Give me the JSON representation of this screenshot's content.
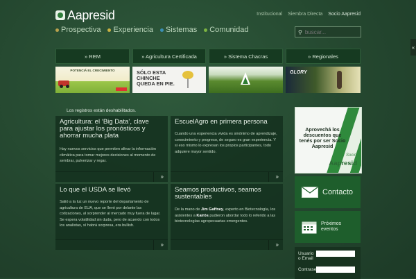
{
  "header": {
    "logo_text": "Aapresid",
    "top_links": [
      "Institucional",
      "Siembra Directa",
      "Socio Aapresid"
    ],
    "main_nav": [
      {
        "label": "Prospectiva",
        "color": "#b9a14d"
      },
      {
        "label": "Experiencia",
        "color": "#c9b243"
      },
      {
        "label": "Sistemas",
        "color": "#3b8fb4"
      },
      {
        "label": "Comunidad",
        "color": "#7cb342"
      }
    ],
    "search_placeholder": "buscar..."
  },
  "categories": [
    {
      "label": "» REM"
    },
    {
      "label": "» Agricultura Certificada"
    },
    {
      "label": "» Sistema Chacras"
    },
    {
      "label": "» Regionales"
    }
  ],
  "banners": [
    {
      "caption": "POTENCIÁ EL CRECIMIENTO"
    },
    {
      "caption": "SÓLO ESTA CHINCHE QUEDA EN PIE."
    },
    {
      "caption": ""
    },
    {
      "caption": "GLORY"
    }
  ],
  "notice": "Los registros están deshabilitados.",
  "cards": [
    {
      "title": "Agricultura: el ‘Big Data’, clave para ajustar los pronósticos y ahorrar mucha plata",
      "body": "Hay nuevos servicios que permiten afinar la información climática para tomar mejores decisiones al momento de sembrar, pulverizar y regar."
    },
    {
      "title": "EscuelAgro en primera persona",
      "body": "Cuando una experiencia vivida es sinónimo de aprendizaje, conocimiento y progreso, de seguro es gran experiencia. Y si eso mismo lo expresan los propios participantes, todo adquiere mayor sentido."
    },
    {
      "title": "Lo que el USDA se llevó",
      "body": "Salió a la luz un nuevo reporte del departamento de agricultura de EUA, que se llevó por delante las cotizaciones, al sorprender al mercado muy fuera de lugar. Se espera volatilidad sin duda, pero de acuerdo con todos los analistas, sí habrá sorpresa, era bullish."
    },
    {
      "title": "Seamos productivos, seamos sustentables",
      "body_pre": "De la mano de ",
      "body_b1": "Jim Gaffney",
      "body_mid": ", experto en Biotecnología, los asistentes a ",
      "body_b2": "Kairós",
      "body_post": " pudieron abordar todo lo referido a las biotecnologías agropecuarias emergentes."
    }
  ],
  "card_more": "»",
  "ad": {
    "text": "Aprovechá los descuentos que tenés por ser Socio Aapresid",
    "socio": "Socio",
    "logo": "Aapresid"
  },
  "contact_label": "Contacto",
  "events_label": "Próximos eventos",
  "login": {
    "user_label": "Usuario o Email",
    "pass_label": "Contraseña"
  },
  "side_tab": "«"
}
